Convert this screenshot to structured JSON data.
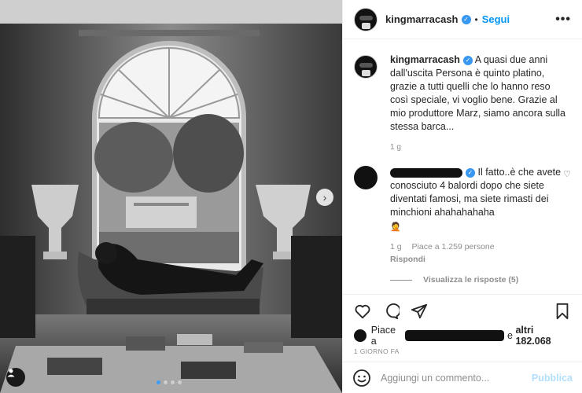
{
  "post": {
    "username": "kingmarracash",
    "follow_label": "Segui",
    "separator": "•",
    "more_label": "•••",
    "caption": "A quasi due anni dall'uscita Persona è quinto platino, grazie a tutti quelli che lo hanno reso così speciale, vi voglio bene. Grazie al mio produttore Marz, siamo ancora sulla stessa barca...",
    "caption_time": "1 g"
  },
  "comment": {
    "text": "Il fatto..è che avete conosciuto 4 balordi dopo che siete diventati famosi, ma siete rimasti dei minchioni ahahahahaha",
    "emoji": "🤦",
    "time": "1 g",
    "likes": "Piace a 1.259 persone",
    "reply_label": "Rispondi",
    "view_replies": "Visualizza le risposte (5)"
  },
  "likes": {
    "prefix": "Piace a",
    "suffix": "e",
    "others": "altri 182.068"
  },
  "date": "1 GIORNO FA",
  "add_comment": {
    "placeholder": "Aggiungi un commento...",
    "publish_label": "Pubblica"
  },
  "carousel": {
    "total_slides": 4,
    "active_slide": 1
  },
  "colors": {
    "accent": "#0095f6",
    "verified": "#3897f0",
    "publish_disabled": "#b2dffc"
  },
  "icons": [
    "chevron-right-icon",
    "tag-user-icon",
    "heart-icon",
    "comment-icon",
    "share-icon",
    "bookmark-icon",
    "emoji-icon",
    "verified-badge-icon"
  ]
}
